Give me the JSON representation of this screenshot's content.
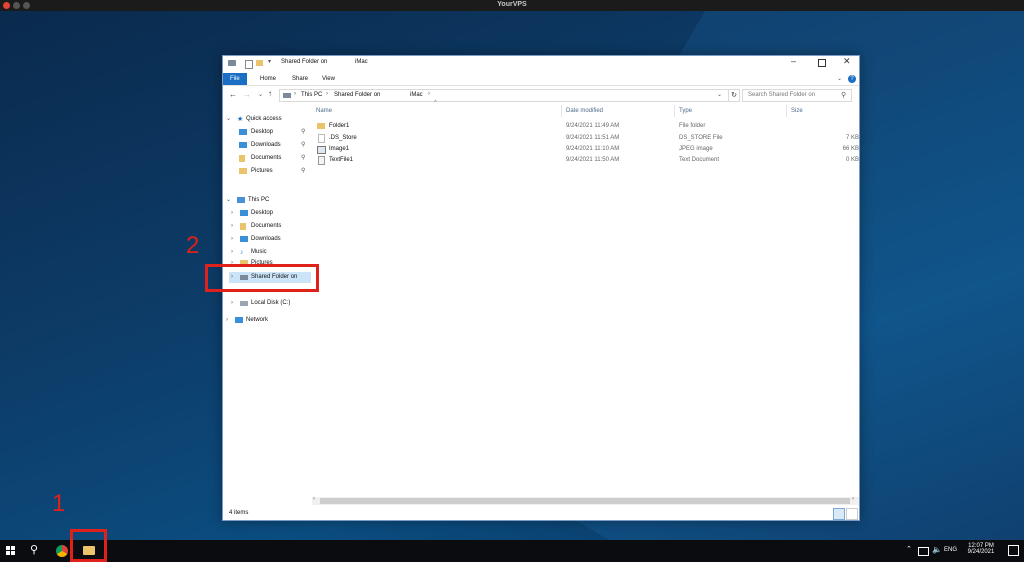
{
  "mac_window": {
    "title": "YourVPS"
  },
  "explorer": {
    "title_path": "Shared Folder on",
    "title_host": "iMac",
    "ribbon_tabs": [
      "File",
      "Home",
      "Share",
      "View"
    ],
    "address": {
      "segment1": "This PC",
      "segment2": "Shared Folder on",
      "segment3": "iMac",
      "search_placeholder": "Search Shared Folder on"
    },
    "nav": {
      "quick_access": "Quick access",
      "quick_items": [
        "Desktop",
        "Downloads",
        "Documents",
        "Pictures"
      ],
      "this_pc": "This PC",
      "pc_items": [
        "Desktop",
        "Documents",
        "Downloads",
        "Music",
        "Pictures"
      ],
      "shared": "Shared Folder on",
      "local_disk": "Local Disk (C:)",
      "network": "Network"
    },
    "columns": {
      "name": "Name",
      "date": "Date modified",
      "type": "Type",
      "size": "Size"
    },
    "files": [
      {
        "name": "Folder1",
        "date": "9/24/2021 11:49 AM",
        "type": "File folder",
        "size": "",
        "icon": "folder"
      },
      {
        "name": ".DS_Store",
        "date": "9/24/2021 11:51 AM",
        "type": "DS_STORE File",
        "size": "7 KB",
        "icon": "blank-file"
      },
      {
        "name": "Image1",
        "date": "9/24/2021 11:10 AM",
        "type": "JPEG image",
        "size": "66 KB",
        "icon": "image-file"
      },
      {
        "name": "TextFile1",
        "date": "9/24/2021 11:50 AM",
        "type": "Text Document",
        "size": "0 KB",
        "icon": "text-file"
      }
    ],
    "status": "4 items"
  },
  "annotations": {
    "step1": "1",
    "step2": "2"
  },
  "taskbar": {
    "lang": "ENG",
    "time": "12:07 PM",
    "date": "9/24/2021"
  },
  "colors": {
    "accent": "#1a6fc4",
    "annotation": "#e0201b",
    "selection": "#cce4f7"
  }
}
